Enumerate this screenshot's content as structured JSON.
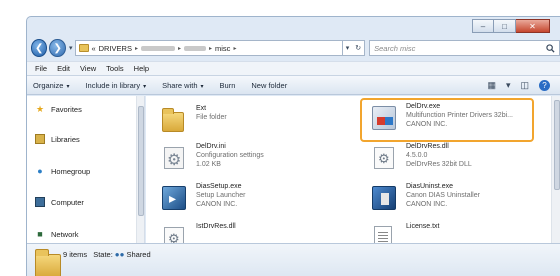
{
  "caption_buttons": {
    "minimize": "–",
    "maximize": "□",
    "close": "✕"
  },
  "nav_buttons": {
    "back": "❮",
    "forward": "❯",
    "dropdown": "▾"
  },
  "address": {
    "prefix": "«",
    "crumbs": [
      "DRIVERS",
      "misc"
    ],
    "separator": "▸",
    "dropdown": "▾",
    "refresh": "↻"
  },
  "search": {
    "placeholder": "Search misc",
    "icon": "search-icon"
  },
  "menu": [
    "File",
    "Edit",
    "View",
    "Tools",
    "Help"
  ],
  "commands": {
    "organize": "Organize",
    "include_in_library": "Include in library",
    "share_with": "Share with",
    "burn": "Burn",
    "new_folder": "New folder",
    "dropdown": "▾"
  },
  "nav_pane": {
    "items": [
      "Favorites",
      "Libraries",
      "Homegroup",
      "Computer",
      "Network"
    ],
    "icons": [
      "star-icon",
      "libraries-icon",
      "homegroup-icon",
      "computer-icon",
      "network-icon"
    ]
  },
  "files": [
    {
      "name": "Ext",
      "line2": "File folder",
      "line3": "",
      "icon": "folder-icon"
    },
    {
      "name": "DelDrv.exe",
      "line2": "Multifunction Printer Drivers 32bi...",
      "line3": "CANON INC.",
      "icon": "installer-icon",
      "highlighted": true
    },
    {
      "name": "DelDrv.ini",
      "line2": "Configuration settings",
      "line3": "1.02 KB",
      "icon": "settings-file-icon"
    },
    {
      "name": "DelDrvRes.dll",
      "line2": "4.5.0.0",
      "line3": "DelDrvRes 32bit DLL",
      "icon": "dll-icon"
    },
    {
      "name": "DiasSetup.exe",
      "line2": "Setup Launcher",
      "line3": "CANON INC.",
      "icon": "setup-icon"
    },
    {
      "name": "DiasUninst.exe",
      "line2": "Canon DIAS Uninstaller",
      "line3": "CANON INC.",
      "icon": "uninstaller-icon"
    },
    {
      "name": "IstDrvRes.dll",
      "line2": "",
      "line3": "",
      "icon": "dll-icon"
    },
    {
      "name": "License.txt",
      "line2": "",
      "line3": "",
      "icon": "text-file-icon"
    }
  ],
  "status": {
    "count": "9 items",
    "state_label": "State:",
    "state_value": "Shared"
  },
  "colors": {
    "highlight": "#f2a52e",
    "window_frame": "#dfe9f5"
  }
}
